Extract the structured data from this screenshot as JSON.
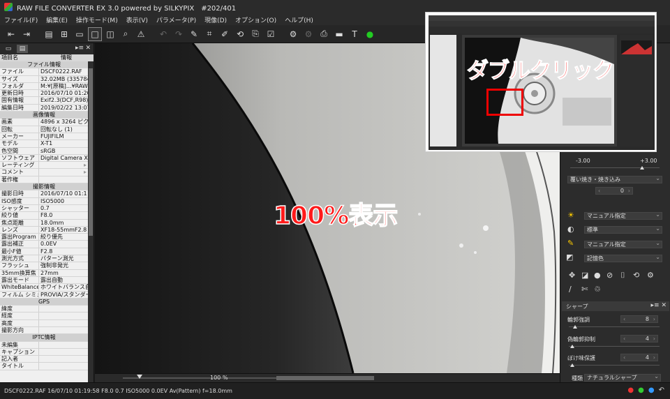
{
  "window": {
    "title": "RAW FILE CONVERTER EX 3.0 powered by SILKYPIX　#202/401"
  },
  "menu": [
    "ファイル(F)",
    "編集(E)",
    "操作モード(M)",
    "表示(V)",
    "パラメータ(P)",
    "現像(D)",
    "オプション(O)",
    "ヘルプ(H)"
  ],
  "info": {
    "header_key": "項目名",
    "header_val": "情報",
    "rows": [
      {
        "k": "",
        "v": "ファイル情報",
        "sec": true
      },
      {
        "k": "ファイル",
        "v": "DSCF0222.RAF"
      },
      {
        "k": "サイズ",
        "v": "32.02MB (3357849"
      },
      {
        "k": "フォルダ",
        "v": "M:¥[原稿]...¥RAW"
      },
      {
        "k": "更新日時",
        "v": "2016/07/10 01:20:"
      },
      {
        "k": "固有情報",
        "v": "Exif2.3(DCF,R98) Y"
      },
      {
        "k": "編集日時",
        "v": "2019/02/22 13:07:"
      },
      {
        "k": "",
        "v": "画像情報",
        "sec": true
      },
      {
        "k": "画素",
        "v": "4896 x 3264 ピクセル"
      },
      {
        "k": "回転",
        "v": "回転なし (1)"
      },
      {
        "k": "メーカー",
        "v": "FUJIFILM"
      },
      {
        "k": "モデル",
        "v": "X-T1"
      },
      {
        "k": "色空間",
        "v": "sRGB"
      },
      {
        "k": "ソフトウェア",
        "v": "Digital Camera X-T"
      },
      {
        "k": "レーティング",
        "v": "",
        "arrow": true
      },
      {
        "k": "コメント",
        "v": "",
        "arrow": true
      },
      {
        "k": "著作権",
        "v": ""
      },
      {
        "k": "",
        "v": "撮影情報",
        "sec": true
      },
      {
        "k": "撮影日時",
        "v": "2016/07/10 01:1"
      },
      {
        "k": "ISO感度",
        "v": "ISO5000"
      },
      {
        "k": "シャッター",
        "v": "0.7"
      },
      {
        "k": "絞り値",
        "v": "F8.0"
      },
      {
        "k": "焦点距離",
        "v": "18.0mm"
      },
      {
        "k": "レンズ",
        "v": "XF18-55mmF2.8"
      },
      {
        "k": "露出Program",
        "v": "絞り優先"
      },
      {
        "k": "露出補正",
        "v": "0.0EV"
      },
      {
        "k": "最小F値",
        "v": "F2.8"
      },
      {
        "k": "測光方式",
        "v": "パターン測光"
      },
      {
        "k": "フラッシュ",
        "v": "強制非発光"
      },
      {
        "k": "35mm換算焦",
        "v": "27mm"
      },
      {
        "k": "露出モード",
        "v": "露出自動"
      },
      {
        "k": "WhiteBalance",
        "v": "ホワイトバランス自動"
      },
      {
        "k": "フィルム シミュレー",
        "v": "PROVIA/スタンダード"
      },
      {
        "k": "",
        "v": "GPS",
        "sec": true
      },
      {
        "k": "緯度",
        "v": ""
      },
      {
        "k": "経度",
        "v": ""
      },
      {
        "k": "高度",
        "v": ""
      },
      {
        "k": "撮影方向",
        "v": ""
      },
      {
        "k": "",
        "v": "IPTC情報",
        "sec": true
      },
      {
        "k": "未編集",
        "v": ""
      },
      {
        "k": "キャプション",
        "v": ""
      },
      {
        "k": "記入者",
        "v": ""
      },
      {
        "k": "タイトル",
        "v": ""
      }
    ]
  },
  "viewer": {
    "overlay_label": "100%表示",
    "zoom_label": "100 %"
  },
  "thumbnail": {
    "label": "ダブルクリック"
  },
  "right": {
    "ev_min": "-3.00",
    "ev_max": "+3.00",
    "burn_label": "覆い焼き・焼き込み",
    "burn_value": "0",
    "wb_preset": "マニュアル指定",
    "contrast": "標準",
    "color_preset": "マニュアル指定",
    "tone": "記憶色",
    "sharp_title": "シャープ",
    "outline_label": "輪郭強調",
    "outline_value": "8",
    "false_contour_label": "偽輪郭抑制",
    "false_contour_value": "4",
    "blur_label": "ぼけ味保護",
    "blur_value": "4",
    "type_label": "種類",
    "type_value": "ナチュラルシャープ"
  },
  "status": {
    "text": "DSCF0222.RAF 16/07/10 01:19:58 F8.0 0.7 ISO5000  0.0EV Av(Pattern) f=18.0mm"
  }
}
